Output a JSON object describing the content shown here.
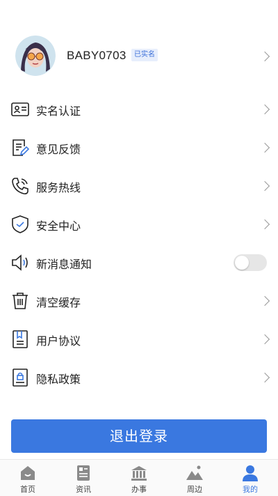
{
  "profile": {
    "username": "BABY0703",
    "verified_badge": "已实名"
  },
  "menu": {
    "items": [
      {
        "label": "实名认证",
        "icon": "id-card-icon"
      },
      {
        "label": "意见反馈",
        "icon": "feedback-edit-icon"
      },
      {
        "label": "服务热线",
        "icon": "phone-icon"
      },
      {
        "label": "安全中心",
        "icon": "shield-check-icon"
      },
      {
        "label": "新消息通知",
        "icon": "speaker-icon",
        "toggle": false
      },
      {
        "label": "清空缓存",
        "icon": "trash-icon"
      },
      {
        "label": "用户协议",
        "icon": "document-icon"
      },
      {
        "label": "隐私政策",
        "icon": "privacy-lock-icon"
      }
    ]
  },
  "logout_label": "退出登录",
  "tabbar": {
    "tabs": [
      {
        "label": "首页",
        "icon": "home-icon"
      },
      {
        "label": "资讯",
        "icon": "news-icon"
      },
      {
        "label": "办事",
        "icon": "government-building-icon"
      },
      {
        "label": "周边",
        "icon": "mountain-icon"
      },
      {
        "label": "我的",
        "icon": "person-icon",
        "active": true
      }
    ]
  },
  "colors": {
    "accent": "#3a78e0",
    "badge_bg": "#e7eefc",
    "toggle_off": "#e6e6e6"
  }
}
